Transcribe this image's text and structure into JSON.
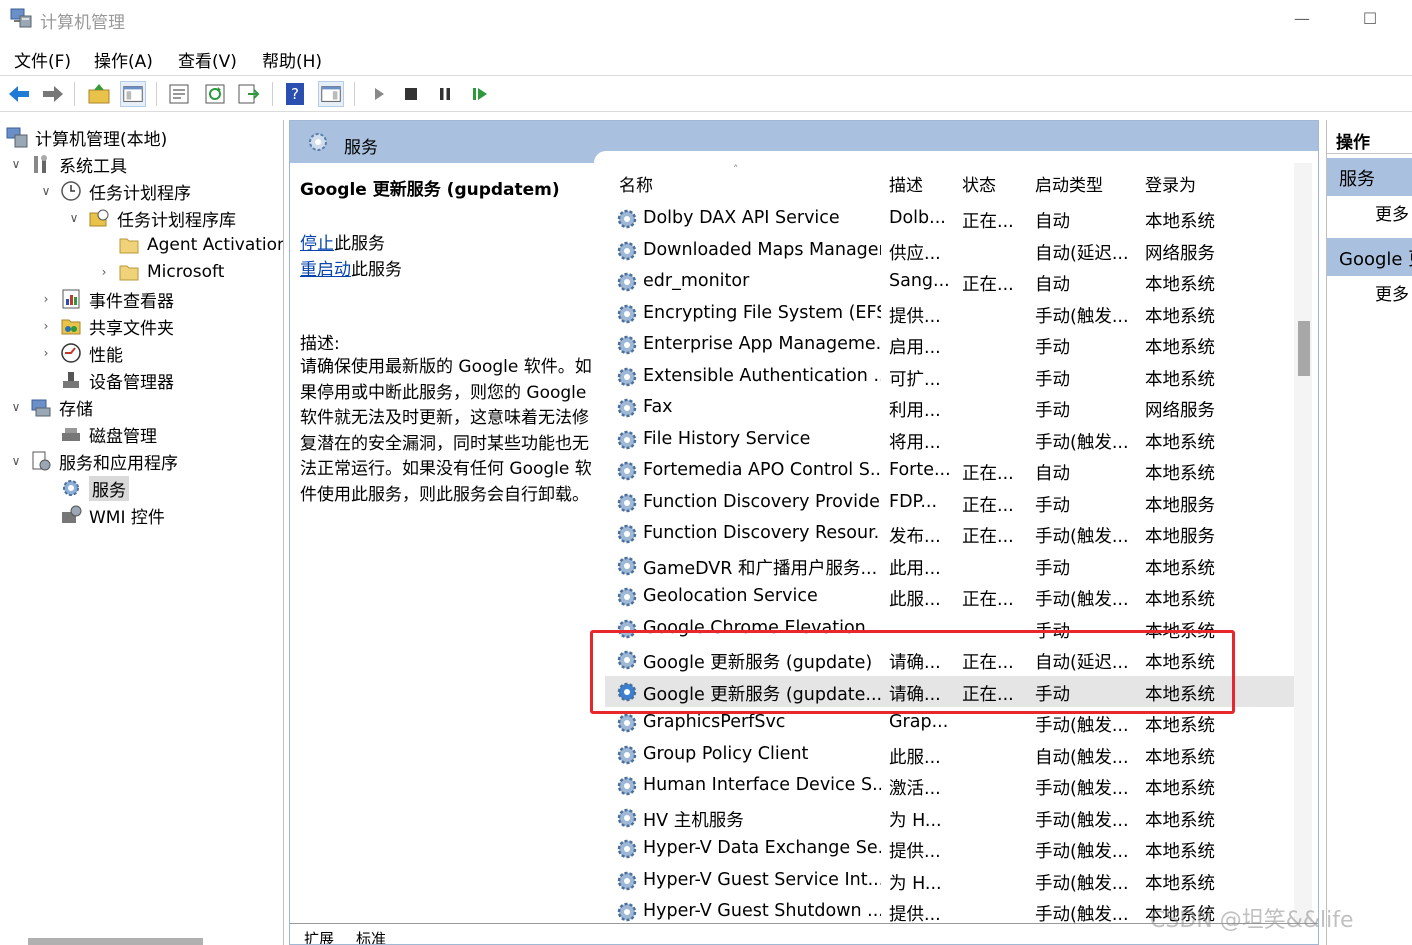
{
  "window": {
    "title": "计算机管理",
    "minimize": "—",
    "maximize": "☐"
  },
  "menu": [
    "文件(F)",
    "操作(A)",
    "查看(V)",
    "帮助(H)"
  ],
  "tree": {
    "root": "计算机管理(本地)",
    "items": [
      {
        "label": "系统工具",
        "chev": "∨"
      },
      {
        "label": "任务计划程序",
        "chev": "∨"
      },
      {
        "label": "任务计划程序库",
        "chev": "∨"
      },
      {
        "label": "Agent Activation",
        "chev": ""
      },
      {
        "label": "Microsoft",
        "chev": "›"
      },
      {
        "label": "事件查看器",
        "chev": "›"
      },
      {
        "label": "共享文件夹",
        "chev": "›"
      },
      {
        "label": "性能",
        "chev": "›"
      },
      {
        "label": "设备管理器",
        "chev": ""
      },
      {
        "label": "存储",
        "chev": "∨"
      },
      {
        "label": "磁盘管理",
        "chev": ""
      },
      {
        "label": "服务和应用程序",
        "chev": "∨"
      },
      {
        "label": "服务",
        "chev": ""
      },
      {
        "label": "WMI 控件",
        "chev": ""
      }
    ]
  },
  "center": {
    "header_title": "服务",
    "detail": {
      "service_name": "Google 更新服务 (gupdatem)",
      "stop_link": "停止",
      "stop_suffix": "此服务",
      "restart_link": "重启动",
      "restart_suffix": "此服务",
      "desc_label": "描述:",
      "desc_text": "请确保使用最新版的 Google 软件。如果停用或中断此服务，则您的 Google 软件就无法及时更新，这意味着无法修复潜在的安全漏洞，同时某些功能也无法正常运行。如果没有任何 Google 软件使用此服务，则此服务会自行卸载。"
    },
    "columns": {
      "name": "名称",
      "desc": "描述",
      "status": "状态",
      "startup": "启动类型",
      "logon": "登录为",
      "sort_indicator": "˄"
    },
    "rows": [
      {
        "name": "Dolby DAX API Service",
        "desc": "Dolb...",
        "status": "正在...",
        "startup": "自动",
        "logon": "本地系统"
      },
      {
        "name": "Downloaded Maps Manager",
        "desc": "供应...",
        "status": "",
        "startup": "自动(延迟...",
        "logon": "网络服务"
      },
      {
        "name": "edr_monitor",
        "desc": "Sang...",
        "status": "正在...",
        "startup": "自动",
        "logon": "本地系统"
      },
      {
        "name": "Encrypting File System (EFS)",
        "desc": "提供...",
        "status": "",
        "startup": "手动(触发...",
        "logon": "本地系统"
      },
      {
        "name": "Enterprise App Manageme...",
        "desc": "启用...",
        "status": "",
        "startup": "手动",
        "logon": "本地系统"
      },
      {
        "name": "Extensible Authentication ...",
        "desc": "可扩...",
        "status": "",
        "startup": "手动",
        "logon": "本地系统"
      },
      {
        "name": "Fax",
        "desc": "利用...",
        "status": "",
        "startup": "手动",
        "logon": "网络服务"
      },
      {
        "name": "File History Service",
        "desc": "将用...",
        "status": "",
        "startup": "手动(触发...",
        "logon": "本地系统"
      },
      {
        "name": "Fortemedia APO Control S...",
        "desc": "Forte...",
        "status": "正在...",
        "startup": "自动",
        "logon": "本地系统"
      },
      {
        "name": "Function Discovery Provide...",
        "desc": "FDP...",
        "status": "正在...",
        "startup": "手动",
        "logon": "本地服务"
      },
      {
        "name": "Function Discovery Resour...",
        "desc": "发布...",
        "status": "正在...",
        "startup": "手动(触发...",
        "logon": "本地服务"
      },
      {
        "name": "GameDVR 和广播用户服务...",
        "desc": "此用...",
        "status": "",
        "startup": "手动",
        "logon": "本地系统"
      },
      {
        "name": "Geolocation Service",
        "desc": "此服...",
        "status": "正在...",
        "startup": "手动(触发...",
        "logon": "本地系统"
      },
      {
        "name": "Google Chrome Elevation ...",
        "desc": "",
        "status": "",
        "startup": "手动",
        "logon": "本地系统"
      },
      {
        "name": "Google 更新服务 (gupdate)",
        "desc": "请确...",
        "status": "正在...",
        "startup": "自动(延迟...",
        "logon": "本地系统"
      },
      {
        "name": "Google 更新服务 (gupdate...",
        "desc": "请确...",
        "status": "正在...",
        "startup": "手动",
        "logon": "本地系统"
      },
      {
        "name": "GraphicsPerfSvc",
        "desc": "Grap...",
        "status": "",
        "startup": "手动(触发...",
        "logon": "本地系统"
      },
      {
        "name": "Group Policy Client",
        "desc": "此服...",
        "status": "",
        "startup": "自动(触发...",
        "logon": "本地系统"
      },
      {
        "name": "Human Interface Device S...",
        "desc": "激活...",
        "status": "",
        "startup": "手动(触发...",
        "logon": "本地系统"
      },
      {
        "name": "HV 主机服务",
        "desc": "为 H...",
        "status": "",
        "startup": "手动(触发...",
        "logon": "本地系统"
      },
      {
        "name": "Hyper-V Data Exchange Se...",
        "desc": "提供...",
        "status": "",
        "startup": "手动(触发...",
        "logon": "本地系统"
      },
      {
        "name": "Hyper-V Guest Service Int...",
        "desc": "为 H...",
        "status": "",
        "startup": "手动(触发...",
        "logon": "本地系统"
      },
      {
        "name": "Hyper-V Guest Shutdown ...",
        "desc": "提供...",
        "status": "",
        "startup": "手动(触发...",
        "logon": "本地系统"
      }
    ],
    "tabs": [
      "扩展",
      "标准"
    ]
  },
  "actions": {
    "title": "操作",
    "section1": "服务",
    "more1": "更多",
    "section2": "Google 更新服务 (gupdatem)",
    "more2": "更多"
  },
  "watermark": "CSDN @坦笑&&life",
  "colors": {
    "header_blue": "#a9c1de",
    "highlight_red": "#e8262b",
    "link_blue": "#0645ad"
  }
}
